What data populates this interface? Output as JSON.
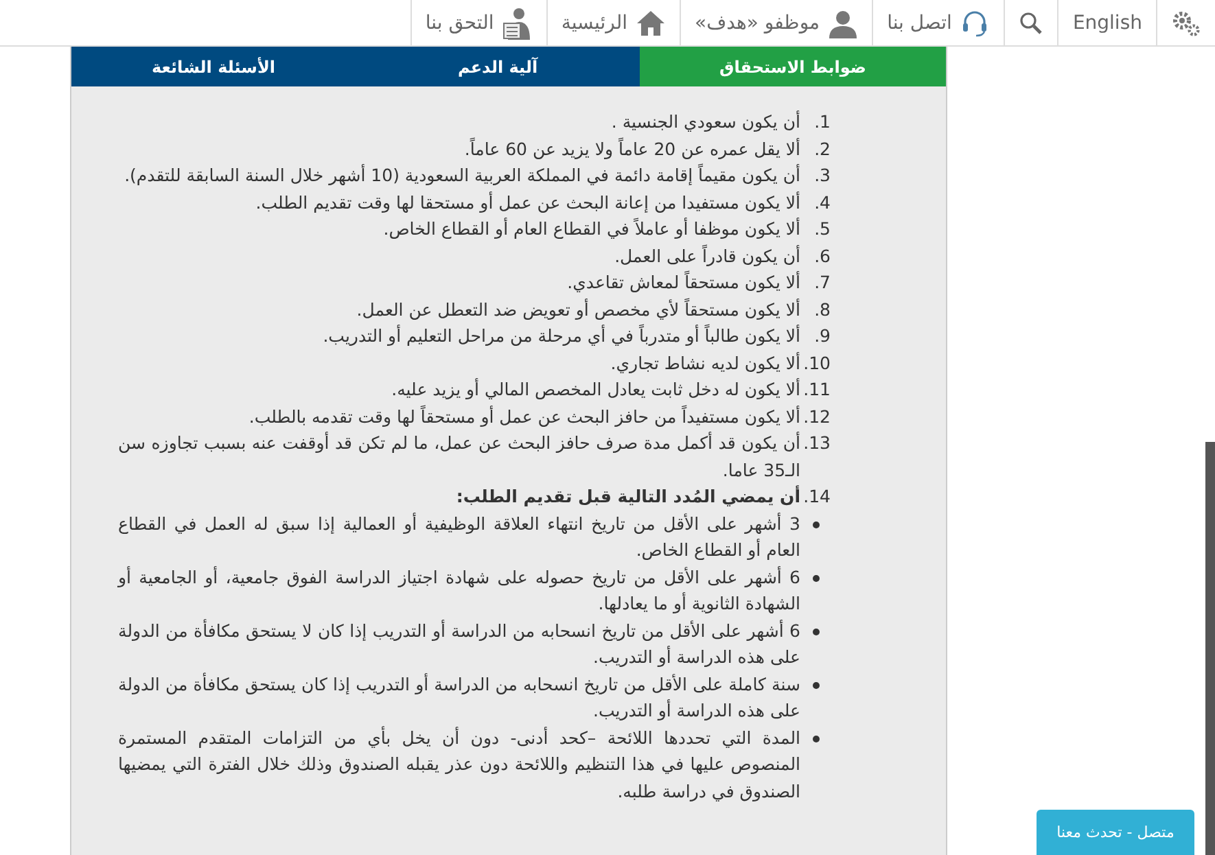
{
  "nav": [
    {
      "kind": "settings"
    },
    {
      "kind": "text",
      "label": "English"
    },
    {
      "kind": "search"
    },
    {
      "kind": "contact",
      "label": "اتصل بنا"
    },
    {
      "kind": "person",
      "label": "موظفو «هدف»"
    },
    {
      "kind": "home",
      "label": "الرئيسية"
    },
    {
      "kind": "join",
      "label": "التحق بنا"
    }
  ],
  "tabs": [
    {
      "label": "ضوابط الاستحقاق",
      "selected": true
    },
    {
      "label": "آلية الدعم",
      "selected": false
    },
    {
      "label": "الأسئلة الشائعة",
      "selected": false
    }
  ],
  "items": [
    {
      "number": "1.",
      "text": "أن يكون سعودي الجنسية .",
      "bold": false
    },
    {
      "number": "2.",
      "text": "ألا يقل عمره عن 20 عاماً ولا يزيد عن 60 عاماً.",
      "bold": false
    },
    {
      "number": "3.",
      "text": "أن يكون مقيماً إقامة دائمة في المملكة العربية السعودية (10 أشهر خلال السنة السابقة للتقدم).",
      "bold": false
    },
    {
      "number": "4.",
      "text": "ألا يكون مستفيدا من إعانة البحث عن عمل أو مستحقا لها وقت تقديم الطلب.",
      "bold": false
    },
    {
      "number": "5.",
      "text": "ألا يكون موظفا أو عاملاً في القطاع العام أو القطاع الخاص.",
      "bold": false
    },
    {
      "number": "6.",
      "text": "أن يكون قادراً على العمل.",
      "bold": false
    },
    {
      "number": "7.",
      "text": "ألا يكون مستحقاً لمعاش تقاعدي.",
      "bold": false
    },
    {
      "number": "8.",
      "text": "ألا يكون مستحقاً لأي مخصص أو تعويض ضد التعطل عن العمل.",
      "bold": false
    },
    {
      "number": "9.",
      "text": "ألا يكون طالباً أو متدرباً في أي مرحلة من مراحل التعليم أو التدريب.",
      "bold": false
    },
    {
      "number": "10.",
      "text": "ألا يكون لديه نشاط تجاري.",
      "bold": false
    },
    {
      "number": "11.",
      "text": "ألا يكون له دخل ثابت يعادل المخصص المالي أو يزيد عليه.",
      "bold": false
    },
    {
      "number": "12.",
      "text": "ألا يكون مستفيداً من حافز البحث عن عمل أو مستحقاً لها وقت تقدمه بالطلب.",
      "bold": false
    },
    {
      "number": "13.",
      "text": "أن يكون قد أكمل مدة صرف حافز البحث عن عمل، ما لم تكن قد أوقفت عنه بسبب تجاوزه سن الـ35 عاما.",
      "bold": false
    },
    {
      "number": "14.",
      "text": "أن يمضي المُدد التالية قبل تقديم الطلب:",
      "bold": true,
      "bullets": [
        "3 أشهر على الأقل من تاريخ انتهاء العلاقة الوظيفية أو العمالية إذا سبق له العمل في القطاع العام أو القطاع الخاص.",
        "6 أشهر على الأقل من تاريخ حصوله على شهادة اجتياز الدراسة الفوق جامعية، أو الجامعية أو الشهادة الثانوية أو ما يعادلها.",
        "6 أشهر على الأقل من تاريخ انسحابه من الدراسة أو التدريب إذا كان لا يستحق مكافأة من الدولة على هذه الدراسة أو التدريب.",
        "سنة كاملة على الأقل من تاريخ انسحابه من الدراسة أو التدريب إذا كان يستحق مكافأة من الدولة على هذه الدراسة أو التدريب.",
        "المدة التي تحددها اللائحة –كحد أدنى- دون أن يخل بأي من التزامات المتقدم المستمرة المنصوص عليها في هذا التنظيم واللائحة دون عذر يقبله الصندوق وذلك خلال الفترة التي يمضيها الصندوق في دراسة طلبه."
      ]
    }
  ],
  "chat_button": "متصل - تحدث معنا"
}
